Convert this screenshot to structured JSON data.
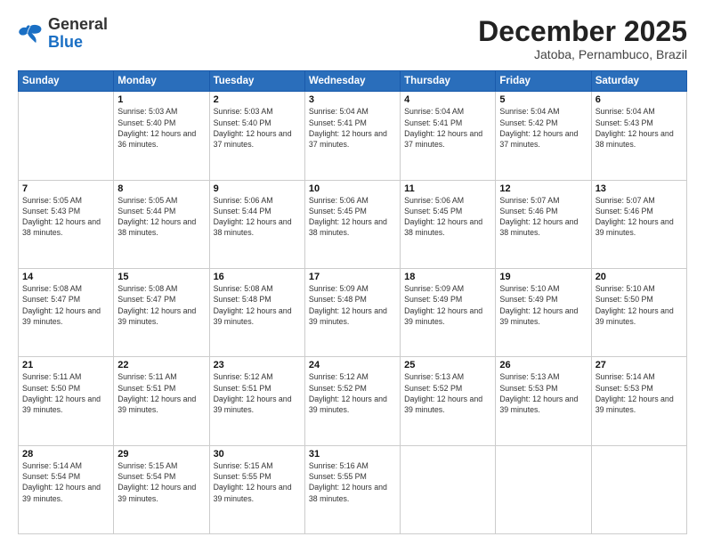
{
  "header": {
    "logo_general": "General",
    "logo_blue": "Blue",
    "title": "December 2025",
    "location": "Jatoba, Pernambuco, Brazil"
  },
  "days_of_week": [
    "Sunday",
    "Monday",
    "Tuesday",
    "Wednesday",
    "Thursday",
    "Friday",
    "Saturday"
  ],
  "weeks": [
    [
      {
        "day": "",
        "sunrise": "",
        "sunset": "",
        "daylight": ""
      },
      {
        "day": "1",
        "sunrise": "Sunrise: 5:03 AM",
        "sunset": "Sunset: 5:40 PM",
        "daylight": "Daylight: 12 hours and 36 minutes."
      },
      {
        "day": "2",
        "sunrise": "Sunrise: 5:03 AM",
        "sunset": "Sunset: 5:40 PM",
        "daylight": "Daylight: 12 hours and 37 minutes."
      },
      {
        "day": "3",
        "sunrise": "Sunrise: 5:04 AM",
        "sunset": "Sunset: 5:41 PM",
        "daylight": "Daylight: 12 hours and 37 minutes."
      },
      {
        "day": "4",
        "sunrise": "Sunrise: 5:04 AM",
        "sunset": "Sunset: 5:41 PM",
        "daylight": "Daylight: 12 hours and 37 minutes."
      },
      {
        "day": "5",
        "sunrise": "Sunrise: 5:04 AM",
        "sunset": "Sunset: 5:42 PM",
        "daylight": "Daylight: 12 hours and 37 minutes."
      },
      {
        "day": "6",
        "sunrise": "Sunrise: 5:04 AM",
        "sunset": "Sunset: 5:43 PM",
        "daylight": "Daylight: 12 hours and 38 minutes."
      }
    ],
    [
      {
        "day": "7",
        "sunrise": "Sunrise: 5:05 AM",
        "sunset": "Sunset: 5:43 PM",
        "daylight": "Daylight: 12 hours and 38 minutes."
      },
      {
        "day": "8",
        "sunrise": "Sunrise: 5:05 AM",
        "sunset": "Sunset: 5:44 PM",
        "daylight": "Daylight: 12 hours and 38 minutes."
      },
      {
        "day": "9",
        "sunrise": "Sunrise: 5:06 AM",
        "sunset": "Sunset: 5:44 PM",
        "daylight": "Daylight: 12 hours and 38 minutes."
      },
      {
        "day": "10",
        "sunrise": "Sunrise: 5:06 AM",
        "sunset": "Sunset: 5:45 PM",
        "daylight": "Daylight: 12 hours and 38 minutes."
      },
      {
        "day": "11",
        "sunrise": "Sunrise: 5:06 AM",
        "sunset": "Sunset: 5:45 PM",
        "daylight": "Daylight: 12 hours and 38 minutes."
      },
      {
        "day": "12",
        "sunrise": "Sunrise: 5:07 AM",
        "sunset": "Sunset: 5:46 PM",
        "daylight": "Daylight: 12 hours and 38 minutes."
      },
      {
        "day": "13",
        "sunrise": "Sunrise: 5:07 AM",
        "sunset": "Sunset: 5:46 PM",
        "daylight": "Daylight: 12 hours and 39 minutes."
      }
    ],
    [
      {
        "day": "14",
        "sunrise": "Sunrise: 5:08 AM",
        "sunset": "Sunset: 5:47 PM",
        "daylight": "Daylight: 12 hours and 39 minutes."
      },
      {
        "day": "15",
        "sunrise": "Sunrise: 5:08 AM",
        "sunset": "Sunset: 5:47 PM",
        "daylight": "Daylight: 12 hours and 39 minutes."
      },
      {
        "day": "16",
        "sunrise": "Sunrise: 5:08 AM",
        "sunset": "Sunset: 5:48 PM",
        "daylight": "Daylight: 12 hours and 39 minutes."
      },
      {
        "day": "17",
        "sunrise": "Sunrise: 5:09 AM",
        "sunset": "Sunset: 5:48 PM",
        "daylight": "Daylight: 12 hours and 39 minutes."
      },
      {
        "day": "18",
        "sunrise": "Sunrise: 5:09 AM",
        "sunset": "Sunset: 5:49 PM",
        "daylight": "Daylight: 12 hours and 39 minutes."
      },
      {
        "day": "19",
        "sunrise": "Sunrise: 5:10 AM",
        "sunset": "Sunset: 5:49 PM",
        "daylight": "Daylight: 12 hours and 39 minutes."
      },
      {
        "day": "20",
        "sunrise": "Sunrise: 5:10 AM",
        "sunset": "Sunset: 5:50 PM",
        "daylight": "Daylight: 12 hours and 39 minutes."
      }
    ],
    [
      {
        "day": "21",
        "sunrise": "Sunrise: 5:11 AM",
        "sunset": "Sunset: 5:50 PM",
        "daylight": "Daylight: 12 hours and 39 minutes."
      },
      {
        "day": "22",
        "sunrise": "Sunrise: 5:11 AM",
        "sunset": "Sunset: 5:51 PM",
        "daylight": "Daylight: 12 hours and 39 minutes."
      },
      {
        "day": "23",
        "sunrise": "Sunrise: 5:12 AM",
        "sunset": "Sunset: 5:51 PM",
        "daylight": "Daylight: 12 hours and 39 minutes."
      },
      {
        "day": "24",
        "sunrise": "Sunrise: 5:12 AM",
        "sunset": "Sunset: 5:52 PM",
        "daylight": "Daylight: 12 hours and 39 minutes."
      },
      {
        "day": "25",
        "sunrise": "Sunrise: 5:13 AM",
        "sunset": "Sunset: 5:52 PM",
        "daylight": "Daylight: 12 hours and 39 minutes."
      },
      {
        "day": "26",
        "sunrise": "Sunrise: 5:13 AM",
        "sunset": "Sunset: 5:53 PM",
        "daylight": "Daylight: 12 hours and 39 minutes."
      },
      {
        "day": "27",
        "sunrise": "Sunrise: 5:14 AM",
        "sunset": "Sunset: 5:53 PM",
        "daylight": "Daylight: 12 hours and 39 minutes."
      }
    ],
    [
      {
        "day": "28",
        "sunrise": "Sunrise: 5:14 AM",
        "sunset": "Sunset: 5:54 PM",
        "daylight": "Daylight: 12 hours and 39 minutes."
      },
      {
        "day": "29",
        "sunrise": "Sunrise: 5:15 AM",
        "sunset": "Sunset: 5:54 PM",
        "daylight": "Daylight: 12 hours and 39 minutes."
      },
      {
        "day": "30",
        "sunrise": "Sunrise: 5:15 AM",
        "sunset": "Sunset: 5:55 PM",
        "daylight": "Daylight: 12 hours and 39 minutes."
      },
      {
        "day": "31",
        "sunrise": "Sunrise: 5:16 AM",
        "sunset": "Sunset: 5:55 PM",
        "daylight": "Daylight: 12 hours and 38 minutes."
      },
      {
        "day": "",
        "sunrise": "",
        "sunset": "",
        "daylight": ""
      },
      {
        "day": "",
        "sunrise": "",
        "sunset": "",
        "daylight": ""
      },
      {
        "day": "",
        "sunrise": "",
        "sunset": "",
        "daylight": ""
      }
    ]
  ]
}
